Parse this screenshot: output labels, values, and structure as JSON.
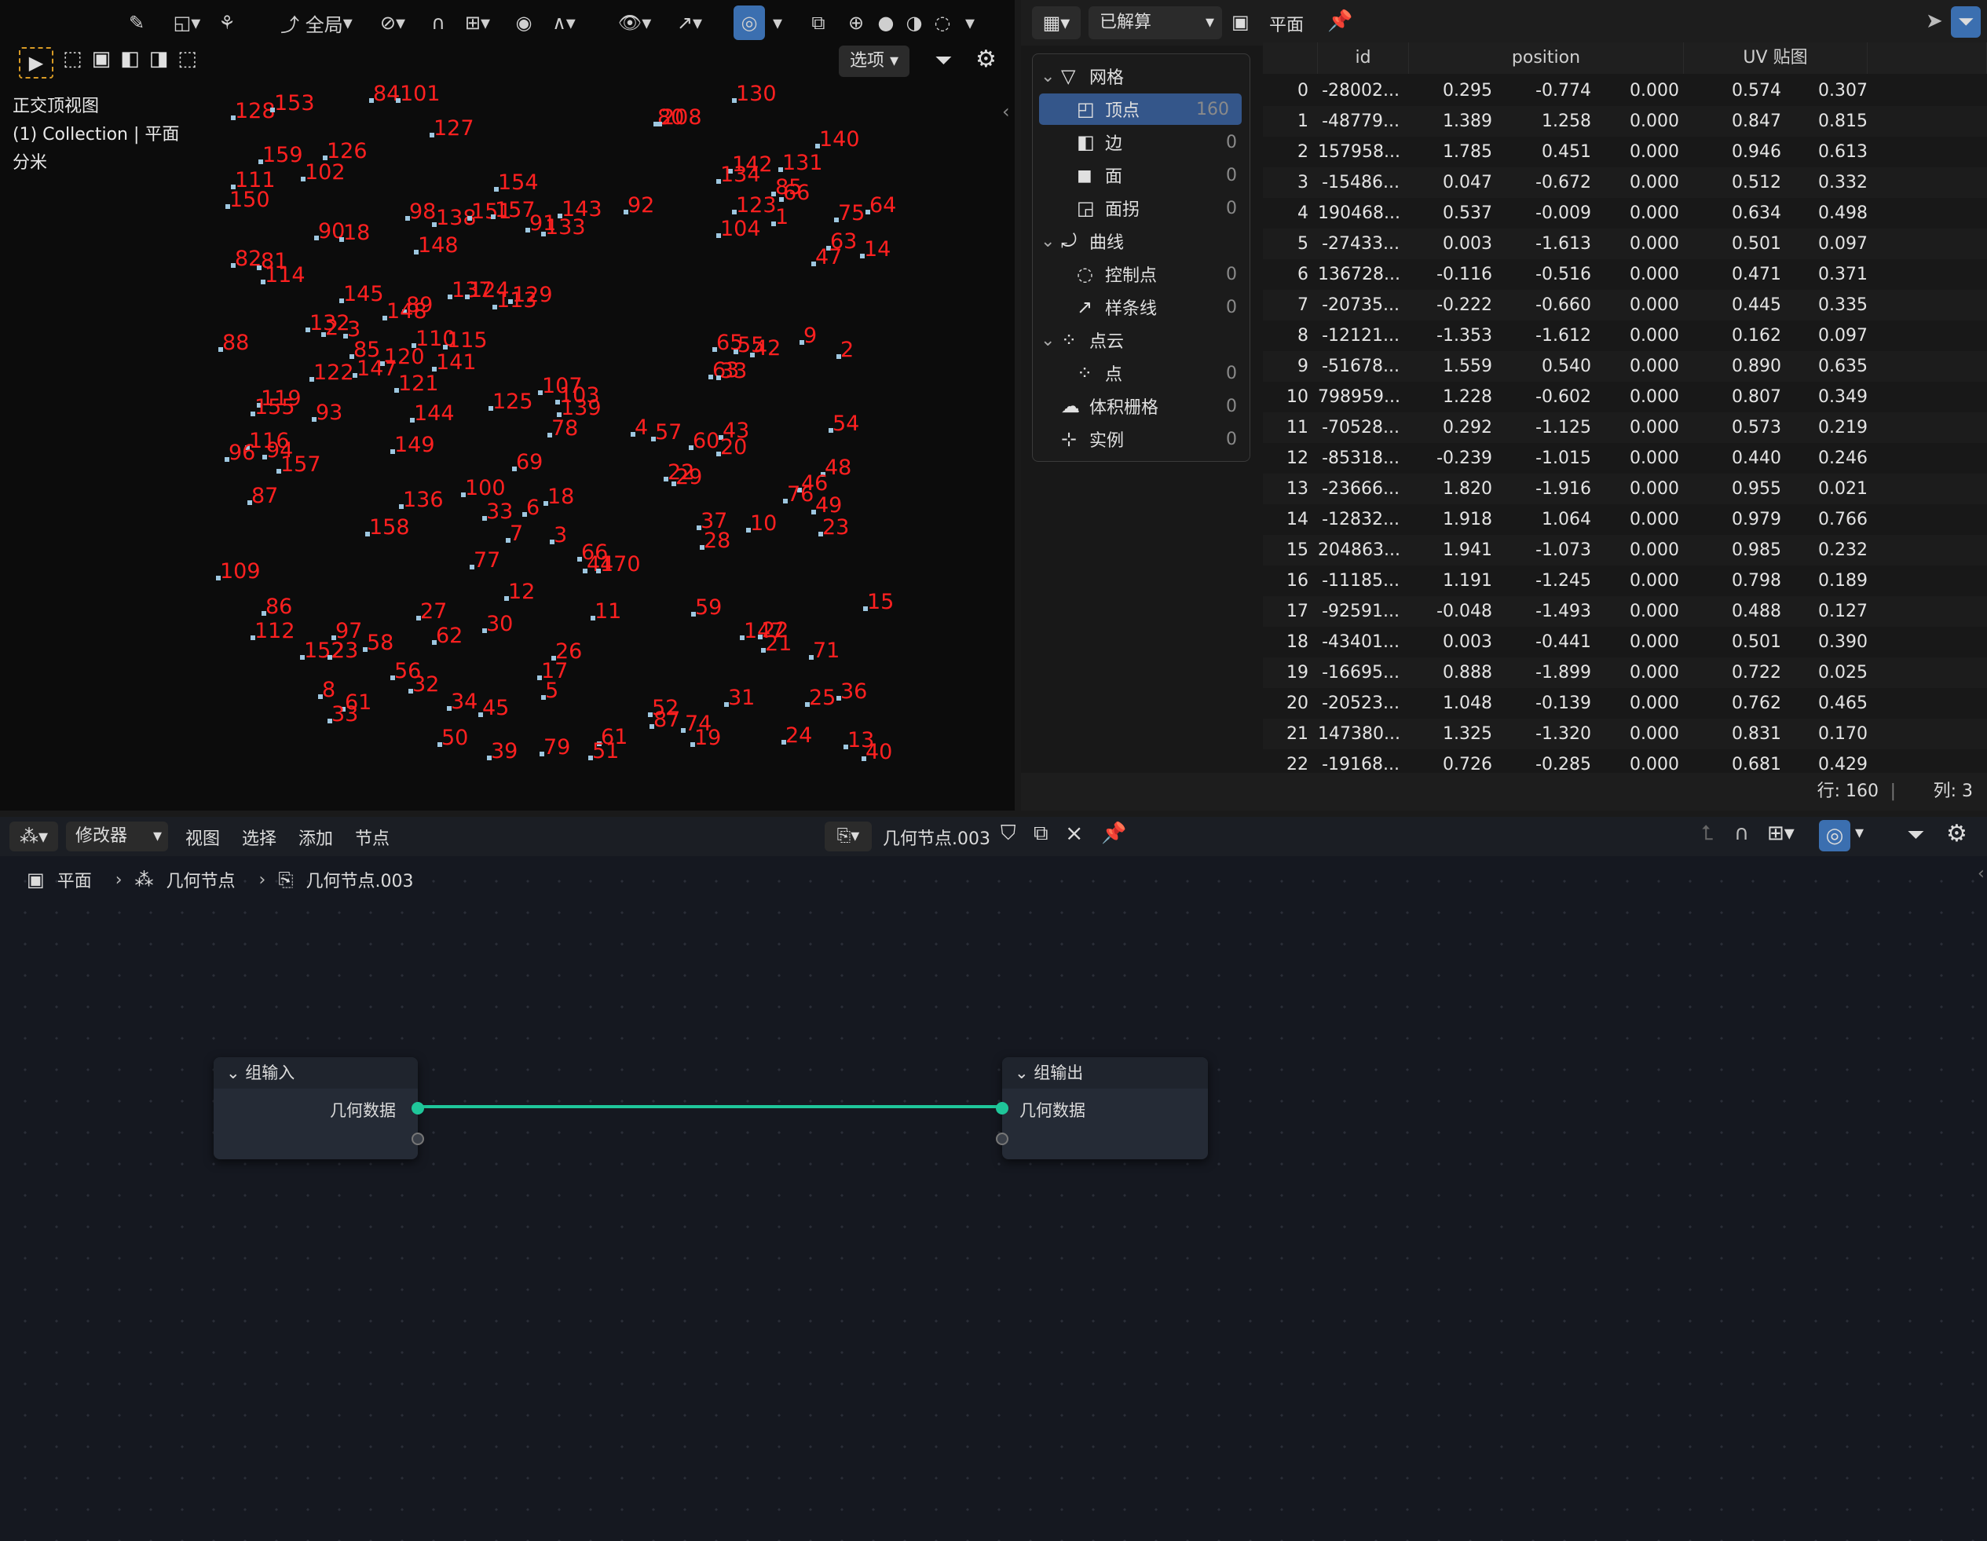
{
  "viewport": {
    "header": {
      "view_mode": "全局",
      "options_label": "选项"
    },
    "info": [
      "正交顶视图",
      "(1) Collection | 平面",
      "分米"
    ],
    "points": [
      [
        "128",
        297,
        150
      ],
      [
        "153",
        347,
        140
      ],
      [
        "84",
        473,
        128
      ],
      [
        "101",
        507,
        128
      ],
      [
        "80",
        835,
        158
      ],
      [
        "208",
        840,
        158
      ],
      [
        "130",
        935,
        128
      ],
      [
        "127",
        550,
        172
      ],
      [
        "140",
        1041,
        186
      ],
      [
        "159",
        332,
        206
      ],
      [
        "126",
        414,
        201
      ],
      [
        "142",
        930,
        218
      ],
      [
        "131",
        994,
        216
      ],
      [
        "134",
        915,
        231
      ],
      [
        "102",
        386,
        228
      ],
      [
        "111",
        297,
        238
      ],
      [
        "154",
        632,
        241
      ],
      [
        "85",
        985,
        247
      ],
      [
        "66",
        995,
        254
      ],
      [
        "150",
        290,
        263
      ],
      [
        "98",
        519,
        278
      ],
      [
        "138",
        553,
        286
      ],
      [
        "151",
        598,
        278
      ],
      [
        "157",
        628,
        276
      ],
      [
        "143",
        713,
        275
      ],
      [
        "92",
        797,
        270
      ],
      [
        "123",
        935,
        270
      ],
      [
        "1",
        985,
        285
      ],
      [
        "75",
        1065,
        280
      ],
      [
        "64",
        1105,
        270
      ],
      [
        "91",
        672,
        293
      ],
      [
        "133",
        692,
        298
      ],
      [
        "104",
        915,
        300
      ],
      [
        "90",
        403,
        303
      ],
      [
        "18",
        435,
        305
      ],
      [
        "63",
        1055,
        316
      ],
      [
        "14",
        1098,
        326
      ],
      [
        "148",
        530,
        321
      ],
      [
        "82",
        297,
        338
      ],
      [
        "81",
        330,
        341
      ],
      [
        "47",
        1036,
        336
      ],
      [
        "114",
        335,
        359
      ],
      [
        "145",
        435,
        383
      ],
      [
        "137",
        573,
        378
      ],
      [
        "124",
        595,
        378
      ],
      [
        "113",
        630,
        391
      ],
      [
        "129",
        650,
        384
      ],
      [
        "89",
        515,
        397
      ],
      [
        "148",
        490,
        405
      ],
      [
        "132",
        392,
        420
      ],
      [
        "2",
        412,
        426
      ],
      [
        "3",
        440,
        428
      ],
      [
        "88",
        281,
        445
      ],
      [
        "110",
        527,
        440
      ],
      [
        "115",
        567,
        442
      ],
      [
        "65",
        910,
        445
      ],
      [
        "55",
        937,
        448
      ],
      [
        "42",
        958,
        452
      ],
      [
        "9",
        1021,
        436
      ],
      [
        "2",
        1068,
        454
      ],
      [
        "85",
        448,
        454
      ],
      [
        "120",
        487,
        463
      ],
      [
        "141",
        553,
        470
      ],
      [
        "147",
        452,
        478
      ],
      [
        "122",
        397,
        483
      ],
      [
        "63",
        905,
        480
      ],
      [
        "33",
        915,
        481
      ],
      [
        "121",
        505,
        497
      ],
      [
        "107",
        688,
        500
      ],
      [
        "103",
        710,
        512
      ],
      [
        "139",
        712,
        528
      ],
      [
        "125",
        625,
        520
      ],
      [
        "119",
        330,
        516
      ],
      [
        "155",
        322,
        527
      ],
      [
        "93",
        400,
        534
      ],
      [
        "144",
        525,
        535
      ],
      [
        "4",
        806,
        553
      ],
      [
        "57",
        832,
        559
      ],
      [
        "43",
        918,
        557
      ],
      [
        "60",
        880,
        570
      ],
      [
        "20",
        915,
        578
      ],
      [
        "54",
        1058,
        548
      ],
      [
        "78",
        700,
        554
      ],
      [
        "116",
        315,
        570
      ],
      [
        "96",
        289,
        585
      ],
      [
        "94",
        337,
        582
      ],
      [
        "157",
        355,
        600
      ],
      [
        "149",
        500,
        575
      ],
      [
        "69",
        655,
        597
      ],
      [
        "48",
        1048,
        604
      ],
      [
        "22",
        848,
        610
      ],
      [
        "29",
        858,
        616
      ],
      [
        "46",
        1018,
        624
      ],
      [
        "76",
        1000,
        638
      ],
      [
        "100",
        590,
        630
      ],
      [
        "18",
        695,
        641
      ],
      [
        "87",
        318,
        640
      ],
      [
        "136",
        511,
        645
      ],
      [
        "33",
        617,
        660
      ],
      [
        "6",
        668,
        655
      ],
      [
        "49",
        1036,
        652
      ],
      [
        "37",
        890,
        672
      ],
      [
        "10",
        953,
        675
      ],
      [
        "23",
        1045,
        680
      ],
      [
        "158",
        468,
        680
      ],
      [
        "7",
        647,
        688
      ],
      [
        "3",
        703,
        690
      ],
      [
        "28",
        894,
        697
      ],
      [
        "77",
        601,
        722
      ],
      [
        "66",
        738,
        712
      ],
      [
        "44",
        745,
        727
      ],
      [
        "170",
        762,
        727
      ],
      [
        "109",
        278,
        736
      ],
      [
        "12",
        645,
        762
      ],
      [
        "15",
        1102,
        775
      ],
      [
        "86",
        336,
        781
      ],
      [
        "27",
        533,
        787
      ],
      [
        "59",
        883,
        782
      ],
      [
        "11",
        755,
        787
      ],
      [
        "30",
        617,
        803
      ],
      [
        "112",
        322,
        812
      ],
      [
        "97",
        425,
        812
      ],
      [
        "62",
        553,
        818
      ],
      [
        "58",
        465,
        827
      ],
      [
        "147",
        945,
        812
      ],
      [
        "22",
        968,
        811
      ],
      [
        "21",
        972,
        828
      ],
      [
        "71",
        1033,
        837
      ],
      [
        "152",
        385,
        837
      ],
      [
        "23",
        420,
        837
      ],
      [
        "26",
        705,
        838
      ],
      [
        "17",
        687,
        863
      ],
      [
        "56",
        500,
        863
      ],
      [
        "32",
        523,
        880
      ],
      [
        "5",
        692,
        888
      ],
      [
        "8",
        408,
        887
      ],
      [
        "61",
        437,
        903
      ],
      [
        "33",
        420,
        918
      ],
      [
        "34",
        572,
        902
      ],
      [
        "45",
        612,
        910
      ],
      [
        "31",
        925,
        897
      ],
      [
        "25",
        1028,
        897
      ],
      [
        "36",
        1068,
        889
      ],
      [
        "52",
        828,
        910
      ],
      [
        "87",
        830,
        925
      ],
      [
        "74",
        870,
        930
      ],
      [
        "19",
        882,
        948
      ],
      [
        "24",
        998,
        945
      ],
      [
        "13",
        1077,
        951
      ],
      [
        "40",
        1100,
        966
      ],
      [
        "50",
        560,
        948
      ],
      [
        "39",
        623,
        965
      ],
      [
        "79",
        690,
        960
      ],
      [
        "61",
        763,
        947
      ],
      [
        "51",
        752,
        965
      ]
    ]
  },
  "spreadsheet": {
    "header": {
      "state": "已解算",
      "object": "平面"
    },
    "tree": [
      {
        "label": "网格",
        "count": "",
        "level": 0,
        "icon": "mesh-icon"
      },
      {
        "label": "顶点",
        "count": "160",
        "level": 1,
        "icon": "vertex-icon",
        "active": true
      },
      {
        "label": "边",
        "count": "0",
        "level": 1,
        "icon": "edge-icon"
      },
      {
        "label": "面",
        "count": "0",
        "level": 1,
        "icon": "face-icon"
      },
      {
        "label": "面拐",
        "count": "0",
        "level": 1,
        "icon": "face-corner-icon"
      },
      {
        "label": "曲线",
        "count": "",
        "level": 0,
        "icon": "curve-icon"
      },
      {
        "label": "控制点",
        "count": "0",
        "level": 1,
        "icon": "control-point-icon"
      },
      {
        "label": "样条线",
        "count": "0",
        "level": 1,
        "icon": "spline-icon"
      },
      {
        "label": "点云",
        "count": "",
        "level": 0,
        "icon": "point-cloud-icon"
      },
      {
        "label": "点",
        "count": "0",
        "level": 1,
        "icon": "point-icon"
      },
      {
        "label": "体积栅格",
        "count": "0",
        "level": 0,
        "icon": "volume-icon"
      },
      {
        "label": "实例",
        "count": "0",
        "level": 0,
        "icon": "instance-icon"
      }
    ],
    "columns": [
      "id",
      "position",
      "UV 贴图"
    ],
    "rows": [
      [
        "0",
        "-28002...",
        "0.295",
        "-0.774",
        "0.000",
        "0.574",
        "0.307"
      ],
      [
        "1",
        "-48779...",
        "1.389",
        "1.258",
        "0.000",
        "0.847",
        "0.815"
      ],
      [
        "2",
        "157958...",
        "1.785",
        "0.451",
        "0.000",
        "0.946",
        "0.613"
      ],
      [
        "3",
        "-15486...",
        "0.047",
        "-0.672",
        "0.000",
        "0.512",
        "0.332"
      ],
      [
        "4",
        "190468...",
        "0.537",
        "-0.009",
        "0.000",
        "0.634",
        "0.498"
      ],
      [
        "5",
        "-27433...",
        "0.003",
        "-1.613",
        "0.000",
        "0.501",
        "0.097"
      ],
      [
        "6",
        "136728...",
        "-0.116",
        "-0.516",
        "0.000",
        "0.471",
        "0.371"
      ],
      [
        "7",
        "-20735...",
        "-0.222",
        "-0.660",
        "0.000",
        "0.445",
        "0.335"
      ],
      [
        "8",
        "-12121...",
        "-1.353",
        "-1.612",
        "0.000",
        "0.162",
        "0.097"
      ],
      [
        "9",
        "-51678...",
        "1.559",
        "0.540",
        "0.000",
        "0.890",
        "0.635"
      ],
      [
        "10",
        "798959...",
        "1.228",
        "-0.602",
        "0.000",
        "0.807",
        "0.349"
      ],
      [
        "11",
        "-70528...",
        "0.292",
        "-1.125",
        "0.000",
        "0.573",
        "0.219"
      ],
      [
        "12",
        "-85318...",
        "-0.239",
        "-1.015",
        "0.000",
        "0.440",
        "0.246"
      ],
      [
        "13",
        "-23666...",
        "1.820",
        "-1.916",
        "0.000",
        "0.955",
        "0.021"
      ],
      [
        "14",
        "-12832...",
        "1.918",
        "1.064",
        "0.000",
        "0.979",
        "0.766"
      ],
      [
        "15",
        "204863...",
        "1.941",
        "-1.073",
        "0.000",
        "0.985",
        "0.232"
      ],
      [
        "16",
        "-11185...",
        "1.191",
        "-1.245",
        "0.000",
        "0.798",
        "0.189"
      ],
      [
        "17",
        "-92591...",
        "-0.048",
        "-1.493",
        "0.000",
        "0.488",
        "0.127"
      ],
      [
        "18",
        "-43401...",
        "0.003",
        "-0.441",
        "0.000",
        "0.501",
        "0.390"
      ],
      [
        "19",
        "-16695...",
        "0.888",
        "-1.899",
        "0.000",
        "0.722",
        "0.025"
      ],
      [
        "20",
        "-20523...",
        "1.048",
        "-0.139",
        "0.000",
        "0.762",
        "0.465"
      ],
      [
        "21",
        "147380...",
        "1.325",
        "-1.320",
        "0.000",
        "0.831",
        "0.170"
      ],
      [
        "22",
        "-19168...",
        "0.726",
        "-0.285",
        "0.000",
        "0.681",
        "0.429"
      ]
    ],
    "footer": {
      "rows": "行: 160",
      "cols": "列: 3"
    }
  },
  "node_editor": {
    "header": {
      "mode": "修改器",
      "menus": [
        "视图",
        "选择",
        "添加",
        "节点"
      ],
      "tree_name": "几何节点.003"
    },
    "breadcrumb": [
      "平面",
      "几何节点",
      "几何节点.003"
    ],
    "group_input": {
      "title": "组输入",
      "socket": "几何数据"
    },
    "group_output": {
      "title": "组输出",
      "socket": "几何数据"
    },
    "link_color": "#1fc69a"
  }
}
